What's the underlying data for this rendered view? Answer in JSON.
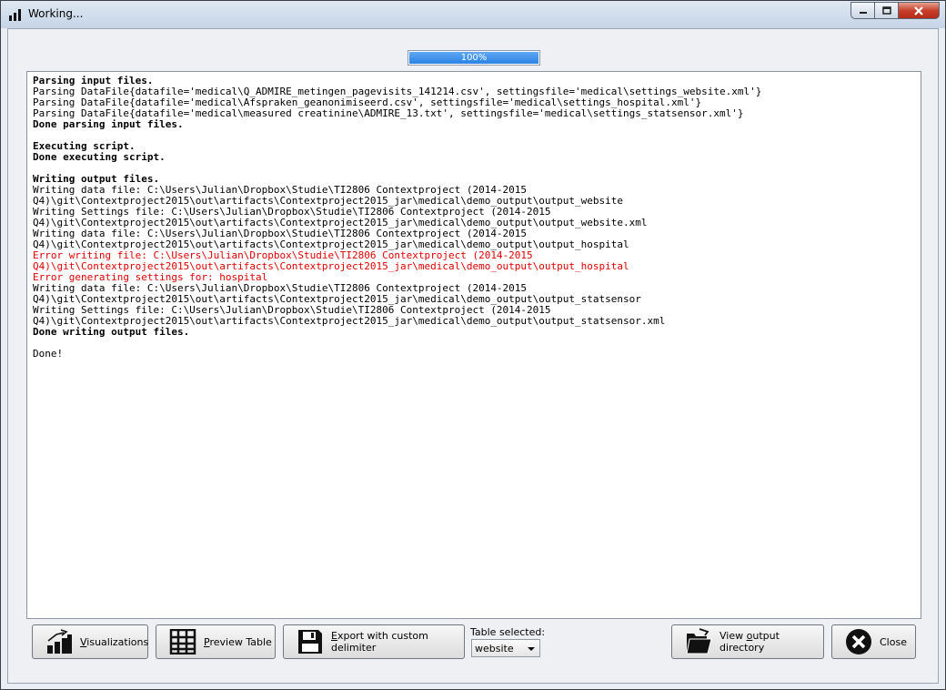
{
  "window": {
    "title": "Working..."
  },
  "progress": {
    "value": 1.0,
    "label": "100%"
  },
  "log": [
    {
      "text": "Parsing input files.",
      "style": "bold"
    },
    {
      "text": "Parsing DataFile{datafile='medical\\Q_ADMIRE_metingen_pagevisits_141214.csv', settingsfile='medical\\settings_website.xml'}",
      "style": "normal"
    },
    {
      "text": "Parsing DataFile{datafile='medical\\Afspraken_geanonimiseerd.csv', settingsfile='medical\\settings_hospital.xml'}",
      "style": "normal"
    },
    {
      "text": "Parsing DataFile{datafile='medical\\measured creatinine\\ADMIRE_13.txt', settingsfile='medical\\settings_statsensor.xml'}",
      "style": "normal"
    },
    {
      "text": "Done parsing input files.",
      "style": "bold"
    },
    {
      "text": "",
      "style": "normal"
    },
    {
      "text": "Executing script.",
      "style": "bold"
    },
    {
      "text": "Done executing script.",
      "style": "bold"
    },
    {
      "text": "",
      "style": "normal"
    },
    {
      "text": "Writing output files.",
      "style": "bold"
    },
    {
      "text": "Writing data file: C:\\Users\\Julian\\Dropbox\\Studie\\TI2806 Contextproject (2014-2015",
      "style": "normal"
    },
    {
      "text": "Q4)\\git\\Contextproject2015\\out\\artifacts\\Contextproject2015_jar\\medical\\demo_output\\output_website",
      "style": "normal"
    },
    {
      "text": "Writing Settings file: C:\\Users\\Julian\\Dropbox\\Studie\\TI2806 Contextproject (2014-2015",
      "style": "normal"
    },
    {
      "text": "Q4)\\git\\Contextproject2015\\out\\artifacts\\Contextproject2015_jar\\medical\\demo_output\\output_website.xml",
      "style": "normal"
    },
    {
      "text": "Writing data file: C:\\Users\\Julian\\Dropbox\\Studie\\TI2806 Contextproject (2014-2015",
      "style": "normal"
    },
    {
      "text": "Q4)\\git\\Contextproject2015\\out\\artifacts\\Contextproject2015_jar\\medical\\demo_output\\output_hospital",
      "style": "normal"
    },
    {
      "text": "Error writing file: C:\\Users\\Julian\\Dropbox\\Studie\\TI2806 Contextproject (2014-2015",
      "style": "error"
    },
    {
      "text": "Q4)\\git\\Contextproject2015\\out\\artifacts\\Contextproject2015_jar\\medical\\demo_output\\output_hospital",
      "style": "error"
    },
    {
      "text": "Error generating settings for: hospital",
      "style": "error"
    },
    {
      "text": "Writing data file: C:\\Users\\Julian\\Dropbox\\Studie\\TI2806 Contextproject (2014-2015",
      "style": "normal"
    },
    {
      "text": "Q4)\\git\\Contextproject2015\\out\\artifacts\\Contextproject2015_jar\\medical\\demo_output\\output_statsensor",
      "style": "normal"
    },
    {
      "text": "Writing Settings file: C:\\Users\\Julian\\Dropbox\\Studie\\TI2806 Contextproject (2014-2015",
      "style": "normal"
    },
    {
      "text": "Q4)\\git\\Contextproject2015\\out\\artifacts\\Contextproject2015_jar\\medical\\demo_output\\output_statsensor.xml",
      "style": "normal"
    },
    {
      "text": "Done writing output files.",
      "style": "bold"
    },
    {
      "text": "",
      "style": "normal"
    },
    {
      "text": "Done!",
      "style": "normal"
    }
  ],
  "buttons": {
    "visualizations": {
      "label_u": "V",
      "label_rest": "isualizations",
      "icon": "bar-chart-icon"
    },
    "preview_table": {
      "label_u": "P",
      "label_rest": "review Table",
      "icon": "table-grid-icon"
    },
    "export": {
      "label_u": "E",
      "label_rest": "xport with custom delimiter",
      "icon": "floppy-disk-icon"
    },
    "view_output": {
      "label_pre": "View ",
      "label_u": "o",
      "label_rest": "utput directory",
      "icon": "open-folder-icon"
    },
    "close": {
      "label": "Close",
      "icon": "close-circle-icon"
    }
  },
  "table_select": {
    "label": "Table selected:",
    "value": "website"
  },
  "colors": {
    "error": "#e00000",
    "progress": "#2a83e6"
  }
}
